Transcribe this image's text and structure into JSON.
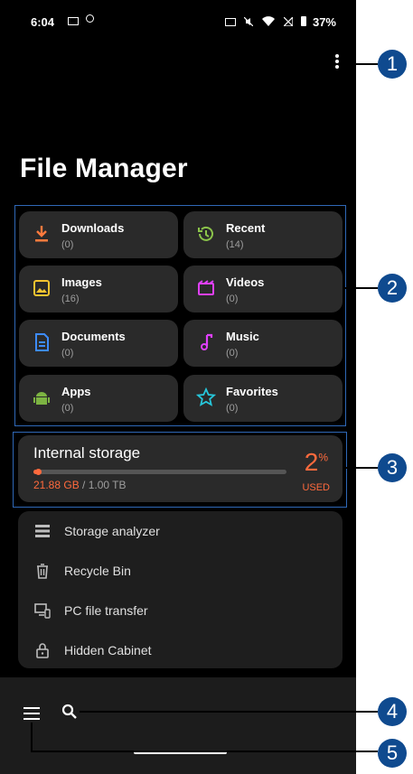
{
  "status_bar": {
    "time": "6:04",
    "battery": "37%"
  },
  "app": {
    "title": "File Manager"
  },
  "categories": [
    {
      "name": "Downloads",
      "count": "(0)",
      "icon": "download-icon"
    },
    {
      "name": "Recent",
      "count": "(14)",
      "icon": "history-icon"
    },
    {
      "name": "Images",
      "count": "(16)",
      "icon": "image-icon"
    },
    {
      "name": "Videos",
      "count": "(0)",
      "icon": "video-icon"
    },
    {
      "name": "Documents",
      "count": "(0)",
      "icon": "document-icon"
    },
    {
      "name": "Music",
      "count": "(0)",
      "icon": "music-icon"
    },
    {
      "name": "Apps",
      "count": "(0)",
      "icon": "android-icon"
    },
    {
      "name": "Favorites",
      "count": "(0)",
      "icon": "star-icon"
    }
  ],
  "storage": {
    "label": "Internal storage",
    "used": "21.88 GB",
    "total": " / 1.00 TB",
    "percent": "2",
    "percent_unit": "%",
    "used_label": "USED",
    "fill_fraction": 0.02
  },
  "tools": [
    {
      "label": "Storage analyzer",
      "icon": "storage-analyzer-icon"
    },
    {
      "label": "Recycle Bin",
      "icon": "trash-icon"
    },
    {
      "label": "PC file transfer",
      "icon": "pc-transfer-icon"
    },
    {
      "label": "Hidden Cabinet",
      "icon": "lock-icon"
    }
  ],
  "callouts": [
    "1",
    "2",
    "3",
    "4",
    "5"
  ],
  "colors": {
    "downloads": "#ff7a3d",
    "recent": "#8bc34a",
    "images": "#f4c430",
    "videos": "#e040fb",
    "documents": "#3d8bff",
    "music": "#e040fb",
    "apps": "#7cb342",
    "favorites": "#26c6da",
    "accent": "#ff6a3d",
    "callout": "#0f4a8f"
  }
}
